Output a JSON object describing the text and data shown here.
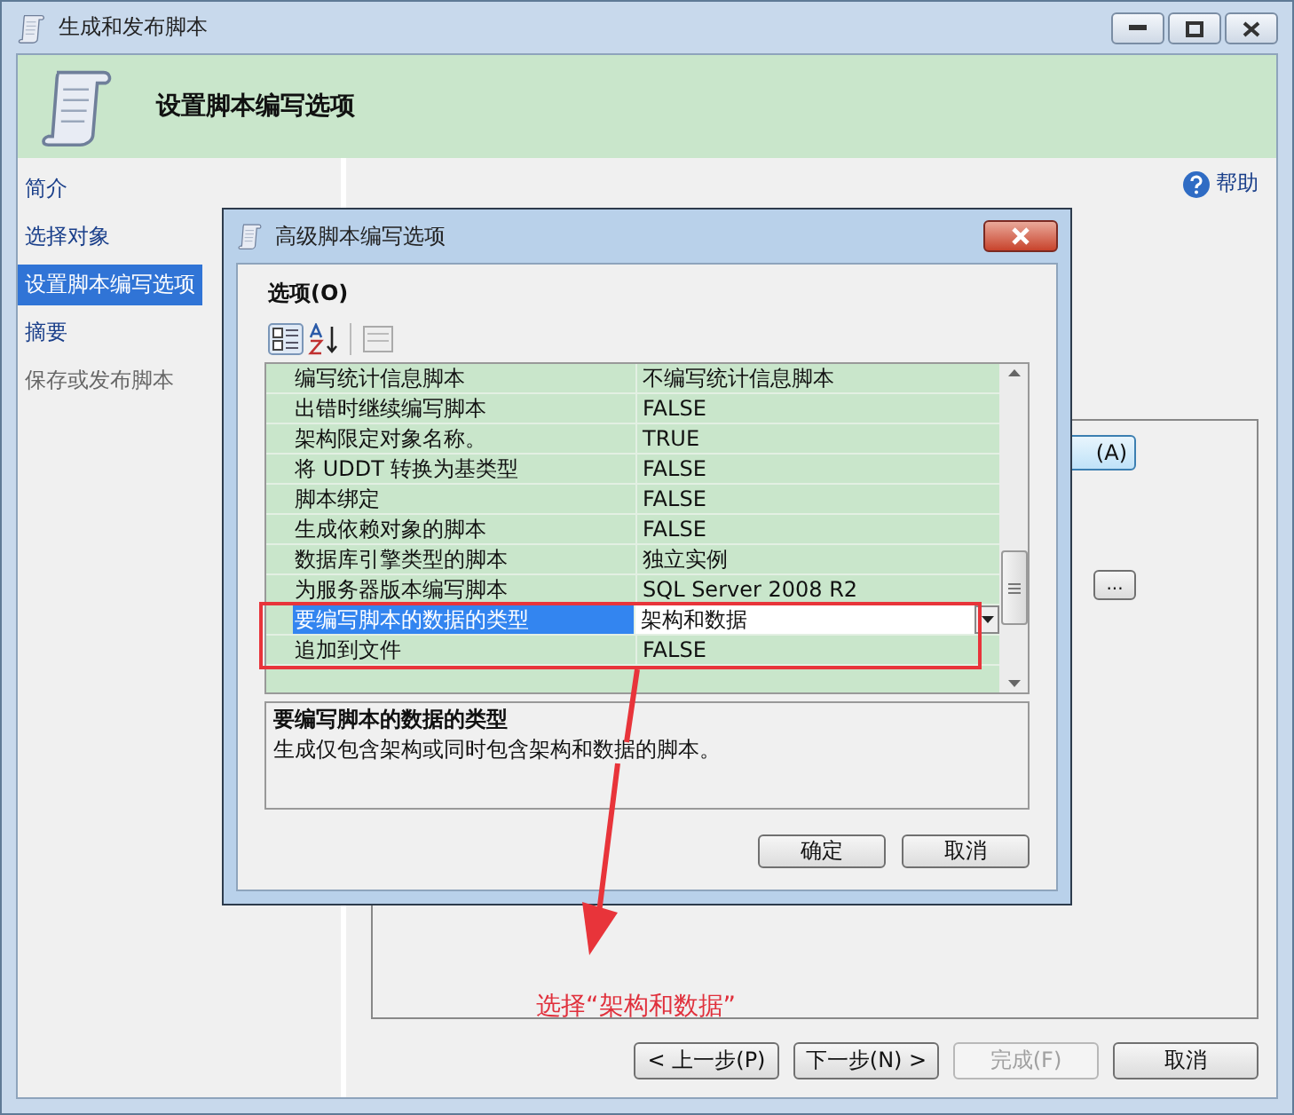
{
  "window": {
    "title": "生成和发布脚本"
  },
  "header": {
    "title": "设置脚本编写选项"
  },
  "sidebar": {
    "items": [
      {
        "label": "简介",
        "selected": false,
        "disabled": false
      },
      {
        "label": "选择对象",
        "selected": false,
        "disabled": false
      },
      {
        "label": "设置脚本编写选项",
        "selected": true,
        "disabled": false
      },
      {
        "label": "摘要",
        "selected": false,
        "disabled": false
      },
      {
        "label": "保存或发布脚本",
        "selected": false,
        "disabled": true
      }
    ]
  },
  "help_link": "帮助",
  "background_buttons": [
    "(A)",
    "..."
  ],
  "dialog": {
    "title": "高级脚本编写选项",
    "section_label": "选项(O)",
    "properties": [
      {
        "name": "编写统计信息脚本",
        "value": "不编写统计信息脚本",
        "selected": false
      },
      {
        "name": "出错时继续编写脚本",
        "value": "FALSE",
        "selected": false
      },
      {
        "name": "架构限定对象名称。",
        "value": "TRUE",
        "selected": false
      },
      {
        "name": "将 UDDT 转换为基类型",
        "value": "FALSE",
        "selected": false
      },
      {
        "name": "脚本绑定",
        "value": "FALSE",
        "selected": false
      },
      {
        "name": "生成依赖对象的脚本",
        "value": "FALSE",
        "selected": false
      },
      {
        "name": "数据库引擎类型的脚本",
        "value": "独立实例",
        "selected": false
      },
      {
        "name": "为服务器版本编写脚本",
        "value": "SQL Server 2008 R2",
        "selected": false
      },
      {
        "name": "要编写脚本的数据的类型",
        "value": "架构和数据",
        "selected": true
      },
      {
        "name": "追加到文件",
        "value": "FALSE",
        "selected": false
      }
    ],
    "description": {
      "title": "要编写脚本的数据的类型",
      "text": "生成仅包含架构或同时包含架构和数据的脚本。"
    },
    "buttons": [
      "确定",
      "取消"
    ]
  },
  "wizard_buttons": [
    {
      "label": "< 上一步(P)",
      "disabled": false
    },
    {
      "label": "下一步(N) >",
      "disabled": false
    },
    {
      "label": "完成(F)",
      "disabled": true
    },
    {
      "label": "取消",
      "disabled": false
    }
  ],
  "annotation": {
    "caption": "选择“架构和数据”"
  }
}
